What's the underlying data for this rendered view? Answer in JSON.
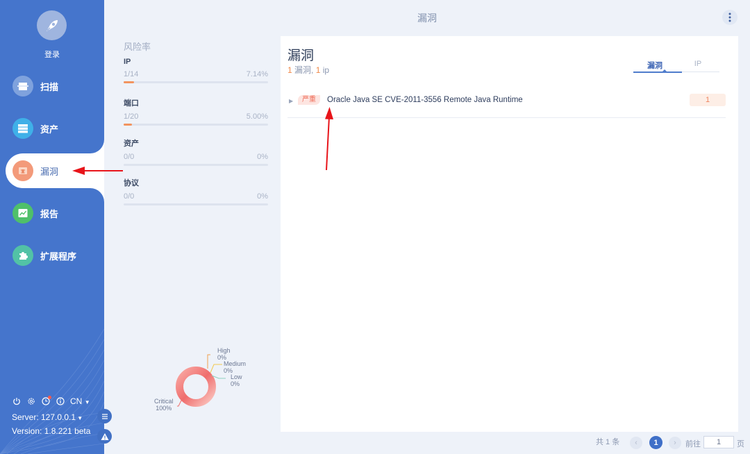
{
  "header": {
    "title": "漏洞"
  },
  "sidebar": {
    "login_label": "登录",
    "items": [
      {
        "label": "扫描",
        "icon": "scan-icon",
        "color": "#7fa2dd"
      },
      {
        "label": "资产",
        "icon": "asset-icon",
        "color": "#3fb0e8"
      },
      {
        "label": "漏洞",
        "icon": "vuln-icon",
        "color": "#f39a7a",
        "active": true
      },
      {
        "label": "报告",
        "icon": "report-icon",
        "color": "#4fc06a"
      },
      {
        "label": "扩展程序",
        "icon": "extension-icon",
        "color": "#52c2a6"
      }
    ],
    "lang": "CN",
    "server": "Server: 127.0.0.1",
    "version": "Version: 1.8.221 beta"
  },
  "risk": {
    "heading": "风险率",
    "metrics": [
      {
        "label": "IP",
        "count": "1/14",
        "percent": "7.14%",
        "fill": 0.0714
      },
      {
        "label": "端口",
        "count": "1/20",
        "percent": "5.00%",
        "fill": 0.05
      },
      {
        "label": "资产",
        "count": "0/0",
        "percent": "0%",
        "fill": 0
      },
      {
        "label": "协议",
        "count": "0/0",
        "percent": "0%",
        "fill": 0
      }
    ]
  },
  "chart_data": {
    "type": "pie",
    "categories": [
      "Critical",
      "High",
      "Medium",
      "Low"
    ],
    "values": [
      100,
      0,
      0,
      0
    ],
    "labels": [
      "100%",
      "0%",
      "0%",
      "0%"
    ],
    "colors": {
      "Critical": "#ef6d6d",
      "High": "#f0a050",
      "Medium": "#f3c94f",
      "Low": "#8fd0c0"
    }
  },
  "main": {
    "title": "漏洞",
    "summary": {
      "vuln_count": "1",
      "vuln_word": "漏洞",
      "sep": ",",
      "ip_count": "1",
      "ip_word": "ip"
    },
    "tabs": [
      {
        "label": "漏洞",
        "active": true
      },
      {
        "label": "IP",
        "active": false
      }
    ],
    "rows": [
      {
        "severity": "严重",
        "name": "Oracle Java SE CVE-2011-3556 Remote Java Runtime",
        "count": "1"
      }
    ]
  },
  "pagination": {
    "total": "共 1 条",
    "current": "1",
    "goto_label": "前往",
    "goto_value": "1",
    "page_unit": "页"
  }
}
